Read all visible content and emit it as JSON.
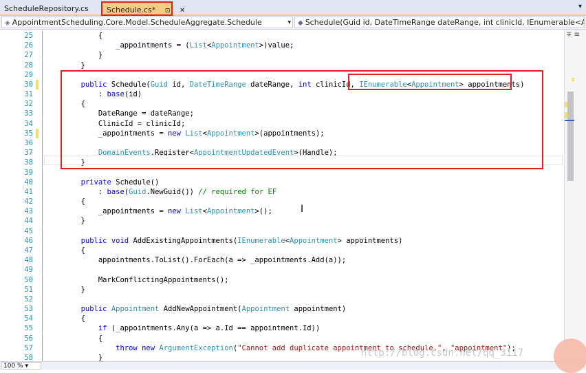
{
  "tabs": [
    {
      "label": "ScheduleRepository.cs"
    },
    {
      "label": "Schedule.cs*",
      "pin": "⊡",
      "close": "✕"
    }
  ],
  "tab_dropdown": "▾",
  "nav": {
    "project": "AppointmentScheduling.Core.Model.ScheduleAggregate.Schedule",
    "member": "Schedule(Guid id, DateTimeRange dateRange, int clinicId, IEnumerable<Appointmer"
  },
  "editor": {
    "lines": [
      {
        "n": "25",
        "tokens": [
          [
            "p",
            "            {"
          ]
        ]
      },
      {
        "n": "26",
        "tokens": [
          [
            "p",
            "                _appointments = ("
          ],
          [
            "t",
            "List"
          ],
          [
            "p",
            "<"
          ],
          [
            "t",
            "Appointment"
          ],
          [
            "p",
            ">)value;"
          ]
        ]
      },
      {
        "n": "27",
        "tokens": [
          [
            "p",
            "            }"
          ]
        ]
      },
      {
        "n": "28",
        "tokens": [
          [
            "p",
            "        }"
          ]
        ]
      },
      {
        "n": "29",
        "tokens": []
      },
      {
        "n": "30",
        "tokens": [
          [
            "k",
            "        public"
          ],
          [
            "p",
            " Schedule("
          ],
          [
            "t",
            "Guid"
          ],
          [
            "p",
            " id, "
          ],
          [
            "t",
            "DateTimeRange"
          ],
          [
            "p",
            " dateRange, "
          ],
          [
            "k",
            "int"
          ],
          [
            "p",
            " clinicId, "
          ],
          [
            "t",
            "IEnumerable"
          ],
          [
            "p",
            "<"
          ],
          [
            "t",
            "Appointment"
          ],
          [
            "p",
            "> appointments)"
          ]
        ]
      },
      {
        "n": "31",
        "tokens": [
          [
            "p",
            "            : "
          ],
          [
            "k",
            "base"
          ],
          [
            "p",
            "(id)"
          ]
        ]
      },
      {
        "n": "32",
        "tokens": [
          [
            "p",
            "        {"
          ]
        ]
      },
      {
        "n": "33",
        "tokens": [
          [
            "p",
            "            DateRange = dateRange;"
          ]
        ]
      },
      {
        "n": "34",
        "tokens": [
          [
            "p",
            "            ClinicId = clinicId;"
          ]
        ]
      },
      {
        "n": "35",
        "tokens": [
          [
            "p",
            "            _appointments = "
          ],
          [
            "k",
            "new"
          ],
          [
            "p",
            " "
          ],
          [
            "t",
            "List"
          ],
          [
            "p",
            "<"
          ],
          [
            "t",
            "Appointment"
          ],
          [
            "p",
            ">(appointments);"
          ]
        ]
      },
      {
        "n": "36",
        "tokens": []
      },
      {
        "n": "37",
        "tokens": [
          [
            "t",
            "            DomainEvents"
          ],
          [
            "p",
            ".Register<"
          ],
          [
            "t",
            "AppointmentUpdatedEvent"
          ],
          [
            "p",
            ">(Handle);"
          ]
        ]
      },
      {
        "n": "38",
        "tokens": [
          [
            "p",
            "        }"
          ]
        ]
      },
      {
        "n": "39",
        "tokens": []
      },
      {
        "n": "40",
        "tokens": [
          [
            "k",
            "        private"
          ],
          [
            "p",
            " Schedule()"
          ]
        ]
      },
      {
        "n": "41",
        "tokens": [
          [
            "p",
            "            : "
          ],
          [
            "k",
            "base"
          ],
          [
            "p",
            "("
          ],
          [
            "t",
            "Guid"
          ],
          [
            "p",
            ".NewGuid()) "
          ],
          [
            "c",
            "// required for EF"
          ]
        ]
      },
      {
        "n": "42",
        "tokens": [
          [
            "p",
            "        {"
          ]
        ]
      },
      {
        "n": "43",
        "tokens": [
          [
            "p",
            "            _appointments = "
          ],
          [
            "k",
            "new"
          ],
          [
            "p",
            " "
          ],
          [
            "t",
            "List"
          ],
          [
            "p",
            "<"
          ],
          [
            "t",
            "Appointment"
          ],
          [
            "p",
            ">();"
          ]
        ]
      },
      {
        "n": "44",
        "tokens": [
          [
            "p",
            "        }"
          ]
        ]
      },
      {
        "n": "45",
        "tokens": []
      },
      {
        "n": "46",
        "tokens": [
          [
            "k",
            "        public"
          ],
          [
            "k",
            " void"
          ],
          [
            "p",
            " AddExistingAppointments("
          ],
          [
            "t",
            "IEnumerable"
          ],
          [
            "p",
            "<"
          ],
          [
            "t",
            "Appointment"
          ],
          [
            "p",
            "> appointments)"
          ]
        ]
      },
      {
        "n": "47",
        "tokens": [
          [
            "p",
            "        {"
          ]
        ]
      },
      {
        "n": "48",
        "tokens": [
          [
            "p",
            "            appointments.ToList().ForEach(a => _appointments.Add(a));"
          ]
        ]
      },
      {
        "n": "49",
        "tokens": []
      },
      {
        "n": "50",
        "tokens": [
          [
            "p",
            "            MarkConflictingAppointments();"
          ]
        ]
      },
      {
        "n": "51",
        "tokens": [
          [
            "p",
            "        }"
          ]
        ]
      },
      {
        "n": "52",
        "tokens": []
      },
      {
        "n": "53",
        "tokens": [
          [
            "k",
            "        public"
          ],
          [
            "p",
            " "
          ],
          [
            "t",
            "Appointment"
          ],
          [
            "p",
            " AddNewAppointment("
          ],
          [
            "t",
            "Appointment"
          ],
          [
            "p",
            " appointment)"
          ]
        ]
      },
      {
        "n": "54",
        "tokens": [
          [
            "p",
            "        {"
          ]
        ]
      },
      {
        "n": "55",
        "tokens": [
          [
            "k",
            "            if"
          ],
          [
            "p",
            " (_appointments.Any(a => a.Id == appointment.Id))"
          ]
        ]
      },
      {
        "n": "56",
        "tokens": [
          [
            "p",
            "            {"
          ]
        ]
      },
      {
        "n": "57",
        "tokens": [
          [
            "k",
            "                throw"
          ],
          [
            "k",
            " new"
          ],
          [
            "p",
            " "
          ],
          [
            "t",
            "ArgumentException"
          ],
          [
            "p",
            "("
          ],
          [
            "s",
            "\"Cannot add duplicate appointment to schedule.\""
          ],
          [
            "p",
            ", "
          ],
          [
            "s",
            "\"appointment\""
          ],
          [
            "p",
            ");"
          ]
        ]
      },
      {
        "n": "58",
        "tokens": [
          [
            "p",
            "            }"
          ]
        ]
      }
    ],
    "modified_lines": [
      "30",
      "35"
    ]
  },
  "cursor_glyph": "I",
  "scrollbar_buttons": "∓ ≡",
  "status": {
    "zoom": "100 %",
    "zoom_dropdown": "▾"
  },
  "watermark": "http://blog.csdn.net/qq_3117"
}
